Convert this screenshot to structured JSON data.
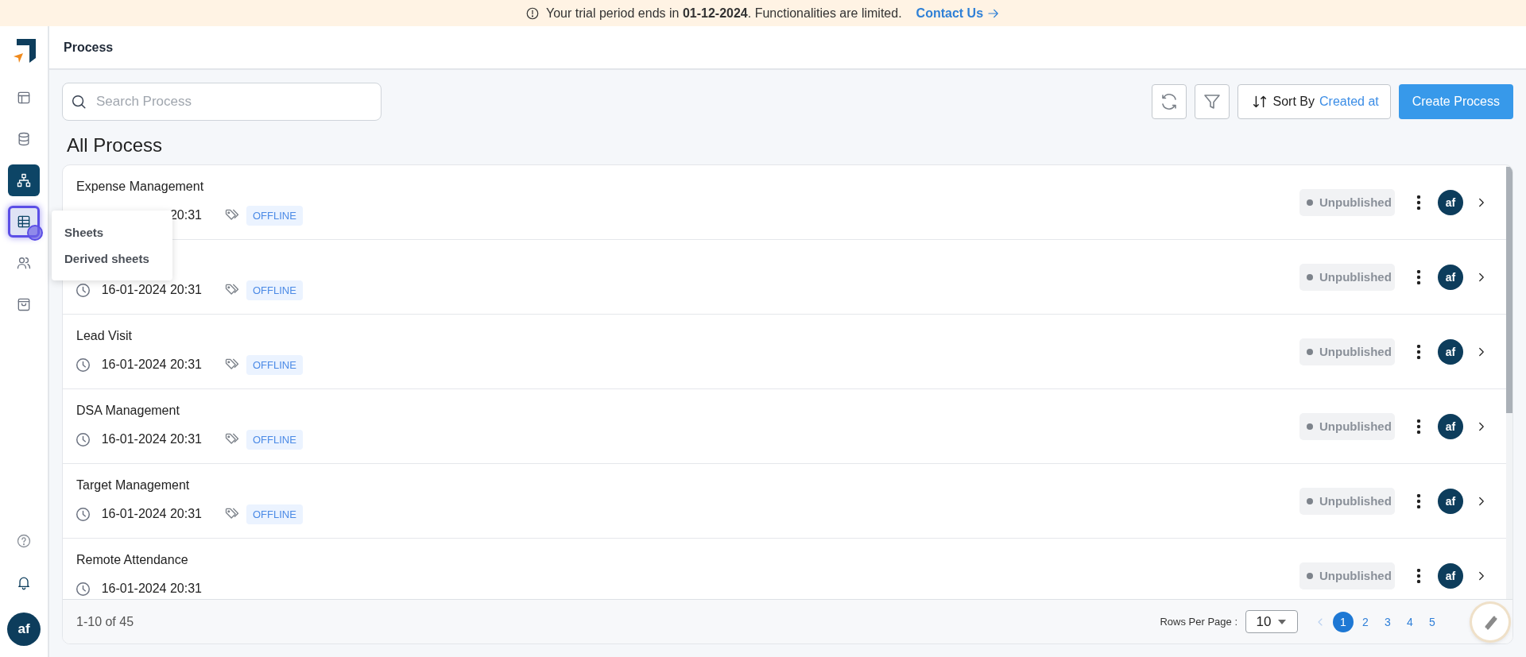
{
  "banner": {
    "text": "Your trial period ends in **01-12-2024**. Functionalities are limited.",
    "link": "Contact Us"
  },
  "sidebar": {
    "items": [
      {
        "kind": "layout",
        "selected": false,
        "hovered": false
      },
      {
        "kind": "database",
        "selected": false,
        "hovered": false
      },
      {
        "kind": "sitemap",
        "selected": true,
        "hovered": false
      },
      {
        "kind": "sheet",
        "selected": false,
        "hovered": true
      },
      {
        "kind": "users",
        "selected": false,
        "hovered": false
      },
      {
        "kind": "bag",
        "selected": false,
        "hovered": false
      }
    ],
    "bottom": [
      {
        "kind": "help"
      },
      {
        "kind": "bell"
      }
    ],
    "user": "af"
  },
  "sheets_menu": {
    "items": [
      "Sheets",
      "Derived sheets"
    ]
  },
  "header": {
    "title": "Process"
  },
  "toolbar": {
    "search_placeholder": "Search Process",
    "sort_label": "Sort By",
    "sort_value": "Created at",
    "create_button": "Create Process"
  },
  "list": {
    "title": "All Process",
    "rows": [
      {
        "name": "Expense Management",
        "date": "20:31",
        "tag": "OFFLINE",
        "status": "Unpublished",
        "owner": "af"
      },
      {
        "date": "16-01-2024 20:31",
        "tag": "OFFLINE",
        "status": "Unpublished",
        "owner": "af"
      },
      {
        "name": "Lead Visit",
        "date": "16-01-2024 20:31",
        "tag": "OFFLINE",
        "status": "Unpublished",
        "owner": "af"
      },
      {
        "name": "DSA Management",
        "date": "16-01-2024 20:31",
        "tag": "OFFLINE",
        "status": "Unpublished",
        "owner": "af"
      },
      {
        "name": "Target Management",
        "date": "16-01-2024 20:31",
        "tag": "OFFLINE",
        "status": "Unpublished",
        "owner": "af"
      },
      {
        "name": "Remote Attendance",
        "date": "16-01-2024 20:31",
        "status": "Unpublished",
        "owner": "af"
      }
    ]
  },
  "footer": {
    "range": "1-10 of 45",
    "rows_per_page_label": "Rows Per Page :",
    "rows_per_page": "10",
    "pages": [
      {
        "label": "1",
        "selected": true
      },
      {
        "label": "2",
        "selected": false
      },
      {
        "label": "3",
        "selected": false
      },
      {
        "label": "4",
        "selected": false
      },
      {
        "label": "5",
        "selected": false
      }
    ]
  }
}
